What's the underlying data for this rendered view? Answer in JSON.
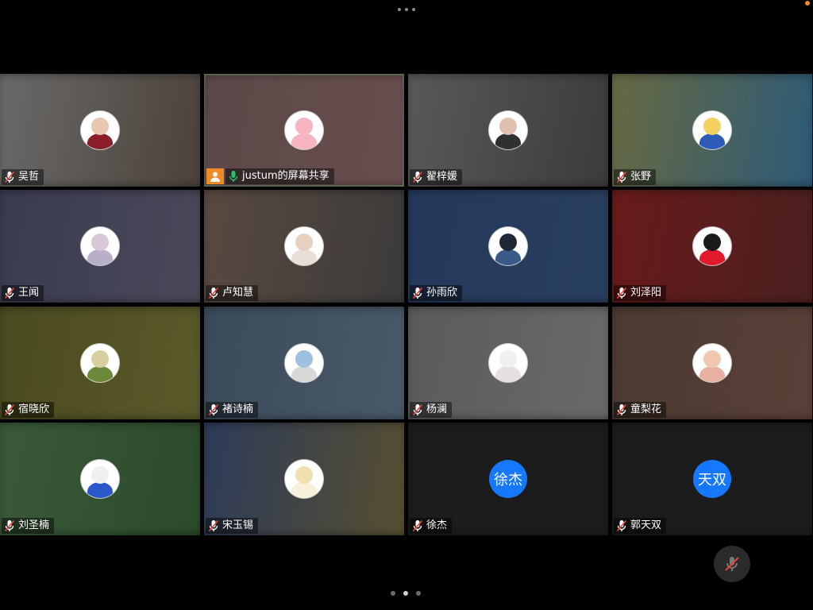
{
  "participants": [
    {
      "name": "吴哲",
      "mic": "muted",
      "avatar": {
        "type": "photo",
        "bg": [
          "#6b6b6b",
          "#4a4038"
        ],
        "face": "#e8c6b0",
        "body": "#8a1f2a"
      }
    },
    {
      "name": "justum的屏幕共享",
      "mic": "active",
      "active_speaker": true,
      "sharing": true,
      "avatar": {
        "type": "photo",
        "bg": [
          "#5a4848",
          "#6a4e4e"
        ],
        "face": "#f6b5c0",
        "body": "#f6b5c0"
      }
    },
    {
      "name": "翟梓媛",
      "mic": "muted",
      "avatar": {
        "type": "photo",
        "bg": [
          "#5a5a5a",
          "#3a3a3a"
        ],
        "face": "#e0c0b0",
        "body": "#303030"
      }
    },
    {
      "name": "张野",
      "mic": "muted",
      "avatar": {
        "type": "photo",
        "bg": [
          "#6a6a40",
          "#2a5a7a"
        ],
        "face": "#f4d060",
        "body": "#2d5bb8"
      }
    },
    {
      "name": "王闻",
      "mic": "muted",
      "avatar": {
        "type": "photo",
        "bg": [
          "#3a3a50",
          "#4a4a5a"
        ],
        "face": "#d8c8d8",
        "body": "#b8b0c8"
      }
    },
    {
      "name": "卢知慧",
      "mic": "muted",
      "avatar": {
        "type": "photo",
        "bg": [
          "#5a4a40",
          "#3a3a3a"
        ],
        "face": "#e8d0c0",
        "body": "#e8e0d8"
      }
    },
    {
      "name": "孙雨欣",
      "mic": "muted",
      "avatar": {
        "type": "photo",
        "bg": [
          "#24385a",
          "#2a4060"
        ],
        "face": "#202838",
        "body": "#3a5a8a"
      }
    },
    {
      "name": "刘泽阳",
      "mic": "muted",
      "avatar": {
        "type": "photo",
        "bg": [
          "#6a1a1a",
          "#4a2020"
        ],
        "face": "#1a1a1a",
        "body": "#e01a2a"
      }
    },
    {
      "name": "宿晓欣",
      "mic": "muted",
      "avatar": {
        "type": "photo",
        "bg": [
          "#4a4a20",
          "#5a5a2a"
        ],
        "face": "#d8d0a0",
        "body": "#6a8a3a"
      }
    },
    {
      "name": "褚诗楠",
      "mic": "muted",
      "avatar": {
        "type": "photo",
        "bg": [
          "#3a4a5a",
          "#4a5a6a"
        ],
        "face": "#a0c0e0",
        "body": "#d8d8d8"
      }
    },
    {
      "name": "杨澜",
      "mic": "muted",
      "avatar": {
        "type": "photo",
        "bg": [
          "#5a5a5a",
          "#6a6a6a"
        ],
        "face": "#f0f0f0",
        "body": "#e8e0e0"
      }
    },
    {
      "name": "童梨花",
      "mic": "muted",
      "avatar": {
        "type": "photo",
        "bg": [
          "#4a3a30",
          "#5a4038"
        ],
        "face": "#f0c8b0",
        "body": "#e8b0a0"
      }
    },
    {
      "name": "刘圣楠",
      "mic": "muted",
      "avatar": {
        "type": "photo",
        "bg": [
          "#3a5a3a",
          "#2a4a2a"
        ],
        "face": "#f0f0f0",
        "body": "#2a58c8"
      }
    },
    {
      "name": "宋玉锡",
      "mic": "muted",
      "avatar": {
        "type": "photo",
        "bg": [
          "#2a3a5a",
          "#5a5030"
        ],
        "face": "#f0e0b0",
        "body": "#f8f0d8"
      }
    },
    {
      "name": "徐杰",
      "mic": "muted",
      "avatar": {
        "type": "initials",
        "text": "徐杰",
        "bg": [
          "#1c1c1c",
          "#1c1c1c"
        ]
      }
    },
    {
      "name": "郭天双",
      "mic": "muted",
      "avatar": {
        "type": "initials",
        "text": "天双",
        "bg": [
          "#1c1c1c",
          "#1c1c1c"
        ]
      }
    }
  ],
  "pager": {
    "count": 3,
    "current": 2
  },
  "colors": {
    "active_border": "#27c26c",
    "share_badge": "#f08a24",
    "initials_avatar": "#1677ff",
    "muted_mic": "#e8453c",
    "active_mic": "#27c26c"
  },
  "icons": {
    "muted": "mic-muted-icon",
    "active": "mic-active-icon",
    "share": "screen-share-icon",
    "mute_button": "mic-off-icon",
    "more": "more-dots-icon"
  }
}
